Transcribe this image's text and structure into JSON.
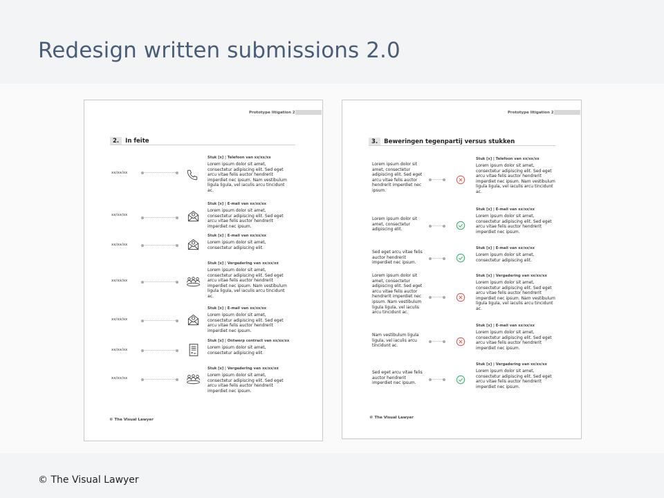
{
  "slide": {
    "title": "Redesign written submissions 2.0",
    "footer": "© The Visual Lawyer"
  },
  "colors": {
    "title": "#4a5d78",
    "success": "#3bb36a",
    "error": "#e05a55"
  },
  "page1": {
    "header": "Prototype litigation 2.0",
    "section_number": "2.",
    "section_title": "In feite",
    "footer": "© The Visual Lawyer",
    "rows": [
      {
        "date": "xx/xx/xx",
        "icon": "phone-icon",
        "title": "Stuk [x] | Telefoon van xx/xx/xx",
        "body": "Lorem ipsum dolor sit amet, consectetur adipiscing elit. Sed eget arcu vitae felis auctor hendrerit imperdiet nec ipsum. Nam vestibulum ligula ligula, vel iaculis arcu tincidunt ac."
      },
      {
        "date": "xx/xx/xx",
        "icon": "email-icon",
        "title": "Stuk [x] | E-mail van xx/xx/xx",
        "body": "Lorem ipsum dolor sit amet, consectetur adipiscing elit. Sed eget arcu vitae felis auctor hendrerit imperdiet nec ipsum."
      },
      {
        "date": "xx/xx/xx",
        "icon": "email-icon",
        "title": "Stuk [x] | E-mail van xx/xx/xx",
        "body": "Lorem ipsum dolor sit amet, consectetur adipiscing elit."
      },
      {
        "date": "xx/xx/xx",
        "icon": "meeting-icon",
        "title": "Stuk [x] | Vergadering van xx/xx/xx",
        "body": "Lorem ipsum dolor sit amet, consectetur adipiscing elit. Sed eget arcu vitae felis auctor hendrerit imperdiet nec ipsum. Nam vestibulum ligula ligula, vel iaculis arcu tincidunt ac."
      },
      {
        "date": "xx/xx/xx",
        "icon": "email-icon",
        "title": "Stuk [x] | E-mail van xx/xx/xx",
        "body": "Lorem ipsum dolor sit amet, consectetur adipiscing elit. Sed eget arcu vitae felis auctor hendrerit imperdiet nec ipsum."
      },
      {
        "date": "xx/xx/xx",
        "icon": "contract-icon",
        "title": "Stuk [x] | Ontwerp contract van xx/xx/xx",
        "body": "Lorem ipsum dolor sit amet, consectetur adipiscing elit."
      },
      {
        "date": "xx/xx/xx",
        "icon": "meeting-icon",
        "title": "Stuk [x] | Vergadering van xx/xx/xx",
        "body": "Lorem ipsum dolor sit amet, consectetur adipiscing elit. Sed eget arcu vitae felis auctor hendrerit imperdiet nec ipsum."
      }
    ]
  },
  "page2": {
    "header": "Prototype litigation 2.0",
    "section_number": "3.",
    "section_title": "Beweringen tegenpartij versus stukken",
    "footer": "© The Visual Lawyer",
    "rows": [
      {
        "claim": "Lorem ipsum dolor sit amet, consectetur adipiscing elit. Sed eget arcu vitae felis auctor hendrerit imperdiet nec ipsum.",
        "status": "error",
        "icon": "cross-circle-icon",
        "title": "Stuk [x] | Telefoon van xx/xx/xx",
        "body": "Lorem ipsum dolor sit amet, consectetur adipiscing elit. Sed eget arcu vitae felis auctor hendrerit imperdiet nec ipsum. Nam vestibulum ligula ligula, vel iaculis arcu tincidunt ac."
      },
      {
        "claim": "Lorem ipsum dolor sit amet, consectetur adipiscing elit.",
        "status": "success",
        "icon": "check-circle-icon",
        "title": "Stuk [x] | E-mail van xx/xx/xx",
        "body": "Lorem ipsum dolor sit amet, consectetur adipiscing elit. Sed eget arcu vitae felis auctor hendrerit imperdiet nec ipsum."
      },
      {
        "claim": "Sed eget arcu vitae felis auctor hendrerit imperdiet nec ipsum.",
        "status": "success",
        "icon": "check-circle-icon",
        "title": "Stuk [x] | E-mail van xx/xx/xx",
        "body": "Lorem ipsum dolor sit amet, consectetur adipiscing elit."
      },
      {
        "claim": "Lorem ipsum dolor sit amet, consectetur adipiscing elit. Sed eget arcu vitae felis auctor hendrerit imperdiet nec ipsum. Nam vestibulum ligula ligula, vel iaculis arcu tincidunt ac.",
        "status": "error",
        "icon": "cross-circle-icon",
        "title": "Stuk [x] | Vergadering van xx/xx/xx",
        "body": "Lorem ipsum dolor sit amet, consectetur adipiscing elit. Sed eget arcu vitae felis auctor hendrerit imperdiet nec ipsum. Nam vestibulum ligula ligula, vel iaculis arcu tincidunt ac."
      },
      {
        "claim": "Nam vestibulum ligula ligula, vel iaculis arcu tincidunt ac.",
        "status": "error",
        "icon": "cross-circle-icon",
        "title": "Stuk [x] | E-mail van xx/xx/xx",
        "body": "Lorem ipsum dolor sit amet, consectetur adipiscing elit. Sed eget arcu vitae felis auctor hendrerit imperdiet nec ipsum."
      },
      {
        "claim": "Sed eget arcu vitae felis auctor hendrerit imperdiet nec ipsum.",
        "status": "success",
        "icon": "check-circle-icon",
        "title": "Stuk [x] | Vergadering van xx/xx/xx",
        "body": "Lorem ipsum dolor sit amet, consectetur adipiscing elit. Sed eget arcu vitae felis auctor hendrerit imperdiet nec ipsum."
      }
    ]
  }
}
